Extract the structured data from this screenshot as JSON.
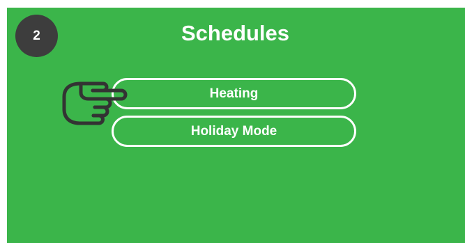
{
  "badge": {
    "number": "2"
  },
  "header": {
    "title": "Schedules"
  },
  "menu": {
    "items": [
      {
        "label": "Heating"
      },
      {
        "label": "Holiday Mode"
      }
    ]
  },
  "pointer": {
    "icon": "pointing-hand-icon",
    "target": "Heating"
  },
  "colors": {
    "background": "#3bb54a",
    "badge": "#3d3d3d",
    "text": "#ffffff",
    "icon_stroke": "#333333"
  }
}
